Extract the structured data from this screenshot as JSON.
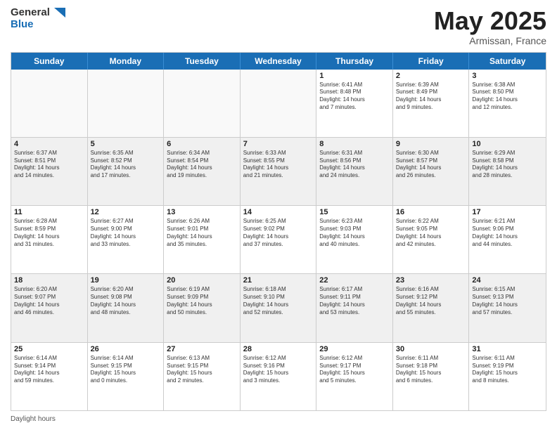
{
  "header": {
    "logo_line1": "General",
    "logo_line2": "Blue",
    "title": "May 2025",
    "location": "Armissan, France"
  },
  "days_of_week": [
    "Sunday",
    "Monday",
    "Tuesday",
    "Wednesday",
    "Thursday",
    "Friday",
    "Saturday"
  ],
  "footer": "Daylight hours",
  "weeks": [
    [
      {
        "day": "",
        "info": "",
        "empty": true
      },
      {
        "day": "",
        "info": "",
        "empty": true
      },
      {
        "day": "",
        "info": "",
        "empty": true
      },
      {
        "day": "",
        "info": "",
        "empty": true
      },
      {
        "day": "1",
        "info": "Sunrise: 6:41 AM\nSunset: 8:48 PM\nDaylight: 14 hours\nand 7 minutes."
      },
      {
        "day": "2",
        "info": "Sunrise: 6:39 AM\nSunset: 8:49 PM\nDaylight: 14 hours\nand 9 minutes."
      },
      {
        "day": "3",
        "info": "Sunrise: 6:38 AM\nSunset: 8:50 PM\nDaylight: 14 hours\nand 12 minutes."
      }
    ],
    [
      {
        "day": "4",
        "info": "Sunrise: 6:37 AM\nSunset: 8:51 PM\nDaylight: 14 hours\nand 14 minutes.",
        "shaded": true
      },
      {
        "day": "5",
        "info": "Sunrise: 6:35 AM\nSunset: 8:52 PM\nDaylight: 14 hours\nand 17 minutes.",
        "shaded": true
      },
      {
        "day": "6",
        "info": "Sunrise: 6:34 AM\nSunset: 8:54 PM\nDaylight: 14 hours\nand 19 minutes.",
        "shaded": true
      },
      {
        "day": "7",
        "info": "Sunrise: 6:33 AM\nSunset: 8:55 PM\nDaylight: 14 hours\nand 21 minutes.",
        "shaded": true
      },
      {
        "day": "8",
        "info": "Sunrise: 6:31 AM\nSunset: 8:56 PM\nDaylight: 14 hours\nand 24 minutes.",
        "shaded": true
      },
      {
        "day": "9",
        "info": "Sunrise: 6:30 AM\nSunset: 8:57 PM\nDaylight: 14 hours\nand 26 minutes.",
        "shaded": true
      },
      {
        "day": "10",
        "info": "Sunrise: 6:29 AM\nSunset: 8:58 PM\nDaylight: 14 hours\nand 28 minutes.",
        "shaded": true
      }
    ],
    [
      {
        "day": "11",
        "info": "Sunrise: 6:28 AM\nSunset: 8:59 PM\nDaylight: 14 hours\nand 31 minutes."
      },
      {
        "day": "12",
        "info": "Sunrise: 6:27 AM\nSunset: 9:00 PM\nDaylight: 14 hours\nand 33 minutes."
      },
      {
        "day": "13",
        "info": "Sunrise: 6:26 AM\nSunset: 9:01 PM\nDaylight: 14 hours\nand 35 minutes."
      },
      {
        "day": "14",
        "info": "Sunrise: 6:25 AM\nSunset: 9:02 PM\nDaylight: 14 hours\nand 37 minutes."
      },
      {
        "day": "15",
        "info": "Sunrise: 6:23 AM\nSunset: 9:03 PM\nDaylight: 14 hours\nand 40 minutes."
      },
      {
        "day": "16",
        "info": "Sunrise: 6:22 AM\nSunset: 9:05 PM\nDaylight: 14 hours\nand 42 minutes."
      },
      {
        "day": "17",
        "info": "Sunrise: 6:21 AM\nSunset: 9:06 PM\nDaylight: 14 hours\nand 44 minutes."
      }
    ],
    [
      {
        "day": "18",
        "info": "Sunrise: 6:20 AM\nSunset: 9:07 PM\nDaylight: 14 hours\nand 46 minutes.",
        "shaded": true
      },
      {
        "day": "19",
        "info": "Sunrise: 6:20 AM\nSunset: 9:08 PM\nDaylight: 14 hours\nand 48 minutes.",
        "shaded": true
      },
      {
        "day": "20",
        "info": "Sunrise: 6:19 AM\nSunset: 9:09 PM\nDaylight: 14 hours\nand 50 minutes.",
        "shaded": true
      },
      {
        "day": "21",
        "info": "Sunrise: 6:18 AM\nSunset: 9:10 PM\nDaylight: 14 hours\nand 52 minutes.",
        "shaded": true
      },
      {
        "day": "22",
        "info": "Sunrise: 6:17 AM\nSunset: 9:11 PM\nDaylight: 14 hours\nand 53 minutes.",
        "shaded": true
      },
      {
        "day": "23",
        "info": "Sunrise: 6:16 AM\nSunset: 9:12 PM\nDaylight: 14 hours\nand 55 minutes.",
        "shaded": true
      },
      {
        "day": "24",
        "info": "Sunrise: 6:15 AM\nSunset: 9:13 PM\nDaylight: 14 hours\nand 57 minutes.",
        "shaded": true
      }
    ],
    [
      {
        "day": "25",
        "info": "Sunrise: 6:14 AM\nSunset: 9:14 PM\nDaylight: 14 hours\nand 59 minutes."
      },
      {
        "day": "26",
        "info": "Sunrise: 6:14 AM\nSunset: 9:15 PM\nDaylight: 15 hours\nand 0 minutes."
      },
      {
        "day": "27",
        "info": "Sunrise: 6:13 AM\nSunset: 9:15 PM\nDaylight: 15 hours\nand 2 minutes."
      },
      {
        "day": "28",
        "info": "Sunrise: 6:12 AM\nSunset: 9:16 PM\nDaylight: 15 hours\nand 3 minutes."
      },
      {
        "day": "29",
        "info": "Sunrise: 6:12 AM\nSunset: 9:17 PM\nDaylight: 15 hours\nand 5 minutes."
      },
      {
        "day": "30",
        "info": "Sunrise: 6:11 AM\nSunset: 9:18 PM\nDaylight: 15 hours\nand 6 minutes."
      },
      {
        "day": "31",
        "info": "Sunrise: 6:11 AM\nSunset: 9:19 PM\nDaylight: 15 hours\nand 8 minutes."
      }
    ]
  ]
}
